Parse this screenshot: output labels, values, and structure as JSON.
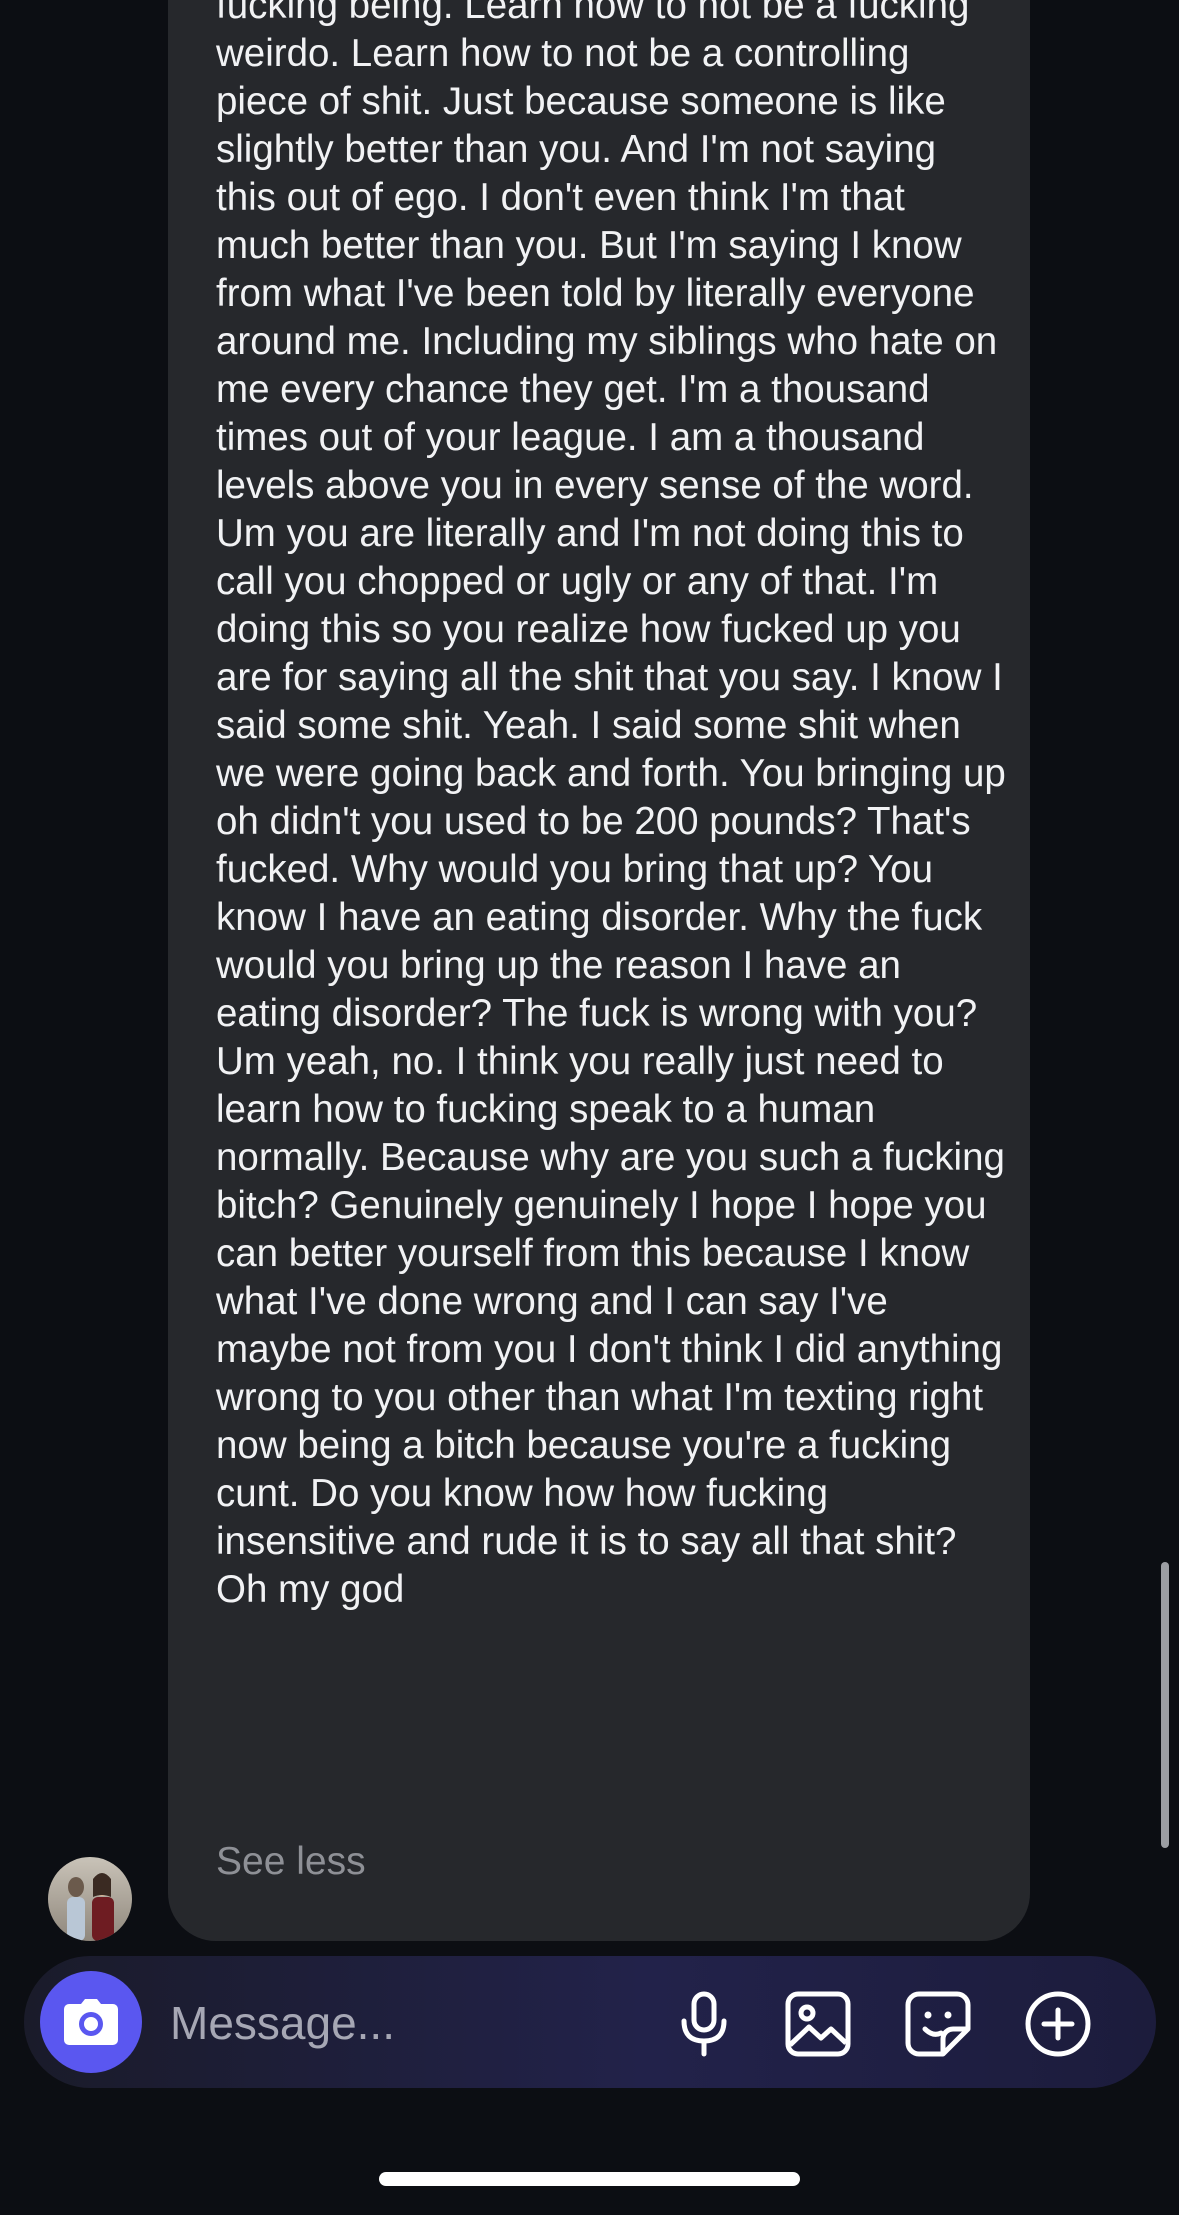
{
  "thread": {
    "message_text": "fucking being. Learn how to not be a fucking weirdo. Learn how to not be a controlling piece of shit. Just because someone is like slightly better than you. And I'm not saying this out of ego. I don't even think I'm that much better than you. But I'm saying I know from what I've been told by literally everyone around me. Including my siblings who hate on me every chance they get. I'm a thousand times out of your league. I am a thousand levels above you in every sense of the word. Um you are literally and I'm not doing this to call you chopped or ugly or any of that. I'm doing this so you realize how fucked up you are for saying all the shit that you say. I know I said some shit. Yeah. I said some shit when we were going back and forth. You bringing up oh didn't you used to be 200 pounds? That's fucked. Why would you bring that up? You know I have an eating disorder. Why the fuck would you bring up the reason I have an eating disorder? The fuck is wrong with you? Um yeah, no. I think you really just need to learn how to fucking speak to a human normally. Because why are you such a fucking bitch? Genuinely genuinely I hope I hope you can better yourself from this because I know what I've done wrong and I can say I've maybe not from you I don't think I did anything wrong to you other than what I'm texting right now being a bitch because you're a fucking cunt. Do you know how how fucking insensitive and rude it is to say all that shit? Oh my god",
    "see_less_label": "See less"
  },
  "composer": {
    "placeholder": "Message...",
    "camera_icon": "camera-icon",
    "mic_icon": "microphone-icon",
    "gallery_icon": "image-icon",
    "sticker_icon": "sticker-icon",
    "more_icon": "plus-circle-icon"
  },
  "colors": {
    "bubble": "#26282c",
    "background": "#0c0e13",
    "accent": "#5a57f0",
    "see_less": "#8e9096"
  }
}
